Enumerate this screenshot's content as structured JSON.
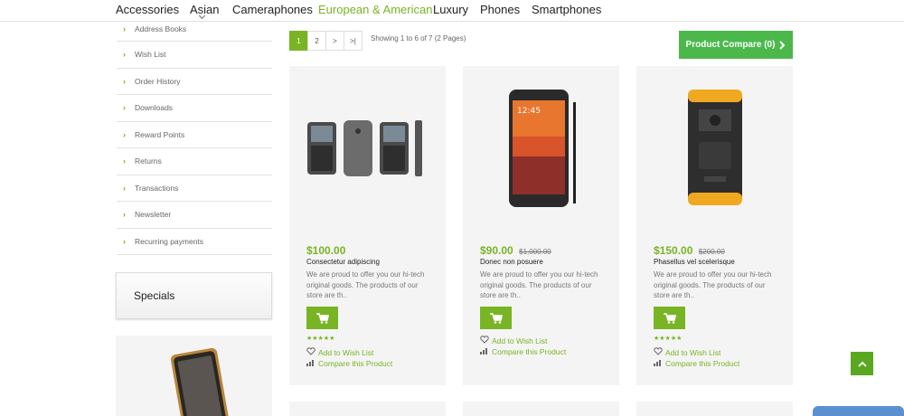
{
  "nav": {
    "items": [
      "Accessories",
      "Asian",
      "Cameraphones",
      "European & American",
      "Luxury",
      "Phones",
      "Smartphones"
    ],
    "active_index": 3
  },
  "sidebar": {
    "links": [
      "Address Books",
      "Wish List",
      "Order History",
      "Downloads",
      "Reward Points",
      "Returns",
      "Transactions",
      "Newsletter",
      "Recurring payments"
    ],
    "specials_title": "Specials"
  },
  "pagination": {
    "pages": [
      "1",
      "2",
      ">",
      ">|"
    ],
    "current": "1",
    "showing": "Showing 1 to 6 of 7 (2 Pages)"
  },
  "compare": {
    "label": "Product Compare (0)"
  },
  "products": [
    {
      "price": "$100.00",
      "old_price": "",
      "name": "Consectetur adipiscing",
      "description": "We are proud to offer you our hi-tech original goods. The products of our store are th..",
      "rating": 5,
      "wishlist": "Add to Wish List",
      "compare": "Compare this Product"
    },
    {
      "price": "$90.00",
      "old_price": "$1,000.00",
      "name": "Donec non posuere",
      "description": "We are proud to offer you our hi-tech original goods. The products of our store are th..",
      "rating": 0,
      "wishlist": "Add to Wish List",
      "compare": "Compare this Product"
    },
    {
      "price": "$150.00",
      "old_price": "$200.00",
      "name": "Phasellus vel scelerisque",
      "description": "We are proud to offer you our hi-tech original goods. The products of our store are th..",
      "rating": 5,
      "wishlist": "Add to Wish List",
      "compare": "Compare this Product"
    }
  ],
  "colors": {
    "accent": "#78b424",
    "compare_button": "#4cb84c",
    "card_bg": "#f4f4f4"
  }
}
